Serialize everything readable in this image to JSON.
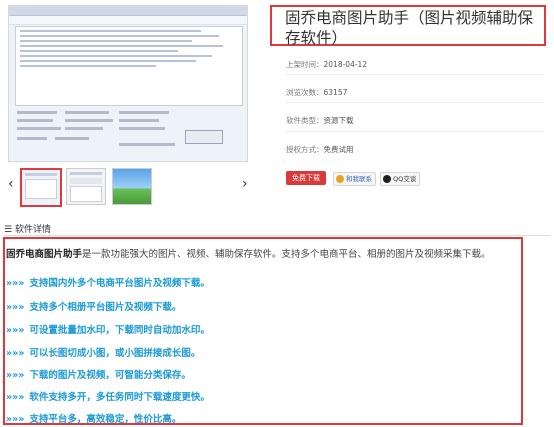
{
  "product": {
    "title": "固乔电商图片助手（图片视频辅助保存软件）",
    "update_label": "上架时间：",
    "update_value": "2018-04-12",
    "views_label": "浏览次数：",
    "views_value": "63157",
    "type_label": "软件类型：",
    "type_value": "资源下载",
    "license_label": "授权方式：",
    "license_value": "免费试用",
    "download_button": "免费下载",
    "partner_label": "和我联系",
    "qq_label": "QQ交谈"
  },
  "gallery": {
    "prev_arrow": "‹",
    "next_arrow": "›",
    "thumbnails": 3,
    "selected_index": 0
  },
  "details": {
    "section_title": "软件详情",
    "intro_name": "固乔电商图片助手",
    "intro_text": "是一款功能强大的图片、视频、辅助保存软件。支持多个电商平台、相册的图片及视频采集下载。",
    "marker": "»»»",
    "features": [
      "支持国内外多个电商平台图片及视频下载。",
      "支持多个相册平台图片及视频下载。",
      "可设置批量加水印，下载同时自动加水印。",
      "可以长图切成小图，或小图拼接成长图。",
      "下载的图片及视频，可智能分类保存。",
      "软件支持多开，多任务同时下载速度更快。",
      "支持平台多，高效稳定，性价比高。"
    ]
  },
  "colors": {
    "accent_red": "#e0383e",
    "feature_blue": "#1a9ad6"
  }
}
